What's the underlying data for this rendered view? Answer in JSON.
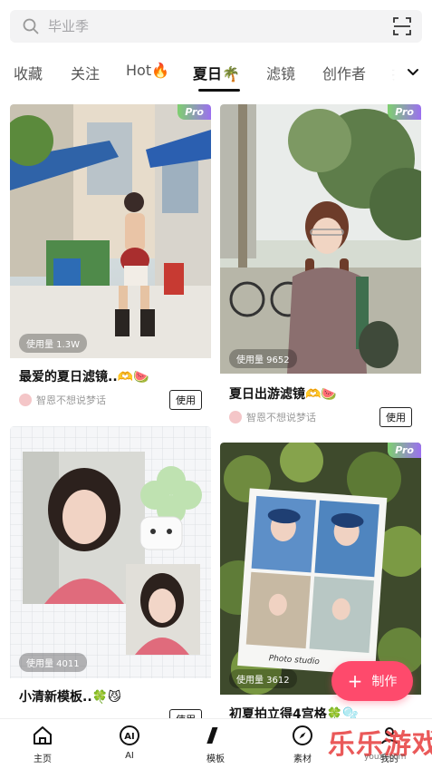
{
  "search": {
    "placeholder": "毕业季"
  },
  "tabs": [
    {
      "label": "收藏"
    },
    {
      "label": "关注"
    },
    {
      "label": "Hot🔥"
    },
    {
      "label": "夏日🌴"
    },
    {
      "label": "滤镜"
    },
    {
      "label": "创作者"
    },
    {
      "label": "扌"
    }
  ],
  "cards": [
    {
      "badge": "Pro",
      "usage": "使用量 1.3W",
      "title": "最爱的夏日滤镜..🫶🍉",
      "author": "智恩不想说梦话",
      "button": "使用"
    },
    {
      "badge": "Pro",
      "usage": "使用量 9652",
      "title": "夏日出游滤镜🫶🍉",
      "author": "智恩不想说梦话",
      "button": "使用"
    },
    {
      "badge": "",
      "usage": "使用量 4011",
      "title": "小清新模板..🍀😼",
      "author": "",
      "button": "使用"
    },
    {
      "badge": "Pro",
      "usage": "使用量 3612",
      "title": "初夏拍立得4宫格🍀🫧",
      "author": "",
      "button": ""
    }
  ],
  "polaroid_caption": "Photo studio",
  "fab": {
    "icon": "+",
    "label": "制作"
  },
  "nav": [
    {
      "label": "主页",
      "icon": "home-icon"
    },
    {
      "label": "AI",
      "icon": "ai-icon"
    },
    {
      "label": "模板",
      "icon": "template-icon"
    },
    {
      "label": "素材",
      "icon": "compass-icon"
    },
    {
      "label": "我的",
      "icon": "profile-icon"
    }
  ],
  "watermark": {
    "text": "乐乐游戏",
    "url": "youxi.com"
  },
  "colors": {
    "accent": "#fe4a6c",
    "pro_gradient_start": "#7ed06f",
    "pro_gradient_end": "#9b6ff0"
  }
}
